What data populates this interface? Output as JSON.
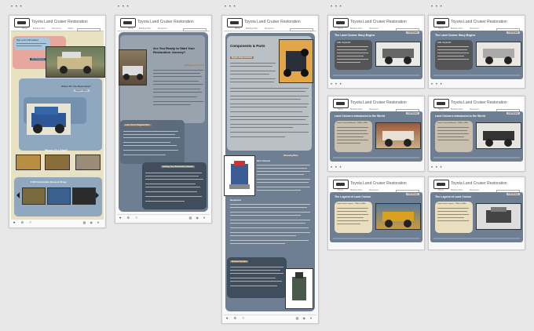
{
  "app": {
    "dots": "• • •",
    "site_title": "Toyota Land Cruiser Restoration",
    "nav": [
      "Home",
      "Building Parts",
      "Resources",
      "Gallery"
    ],
    "footer_left": "♥ ⚙ ⚐",
    "footer_right": "▦ ◉ ▼",
    "full_screen": "Full Screen"
  },
  "card1": {
    "promo_title": "Sign up for FJ40 updates",
    "promo_button": "Join Newsletter",
    "help_heading": "Where Do You Need Help?",
    "help_button": "Search Topics",
    "start_heading": "Where Do I Start?",
    "thumb_labels": [
      "Engine Restoration",
      "Interior Build",
      "Body & Paint"
    ],
    "blogs_heading": "FJ40 Restoration Blogs & Vlogs"
  },
  "card2": {
    "heading": "Are You Ready to Start Your Restoration Journey?",
    "sub": "Budgeting and Costs",
    "sec1": "Learn About Original Parts",
    "sec2": "Getting Your Restoration Started"
  },
  "card3": {
    "heading": "Components & Parts",
    "tag1": "Engine Improvements",
    "tag2": "Choosing Parts",
    "tag3": "Exhaust System",
    "sub1": "Part 1 Chassis",
    "sub2": "Suspension"
  },
  "story": {
    "heading": "The Land Cruiser Story Begins",
    "date": "1951 Toyota BJ",
    "button": "Read"
  },
  "intro": {
    "heading": "Land Cruisers Introduced to the World",
    "caption": "Land Cruiser Introduced – 1960 to 1968",
    "button": "Read"
  },
  "legend": {
    "heading": "The Legend of Land Cruiser",
    "caption": "Land Cruiser Legend – 1960 to 1980s",
    "button": "Read"
  },
  "colors": {
    "page_bg": "#e8e8e8",
    "blue_panel": "#6e7f93",
    "dark_panel": "#4b5868",
    "tan_panel": "#c8bfae",
    "orange": "#e2a54a"
  }
}
